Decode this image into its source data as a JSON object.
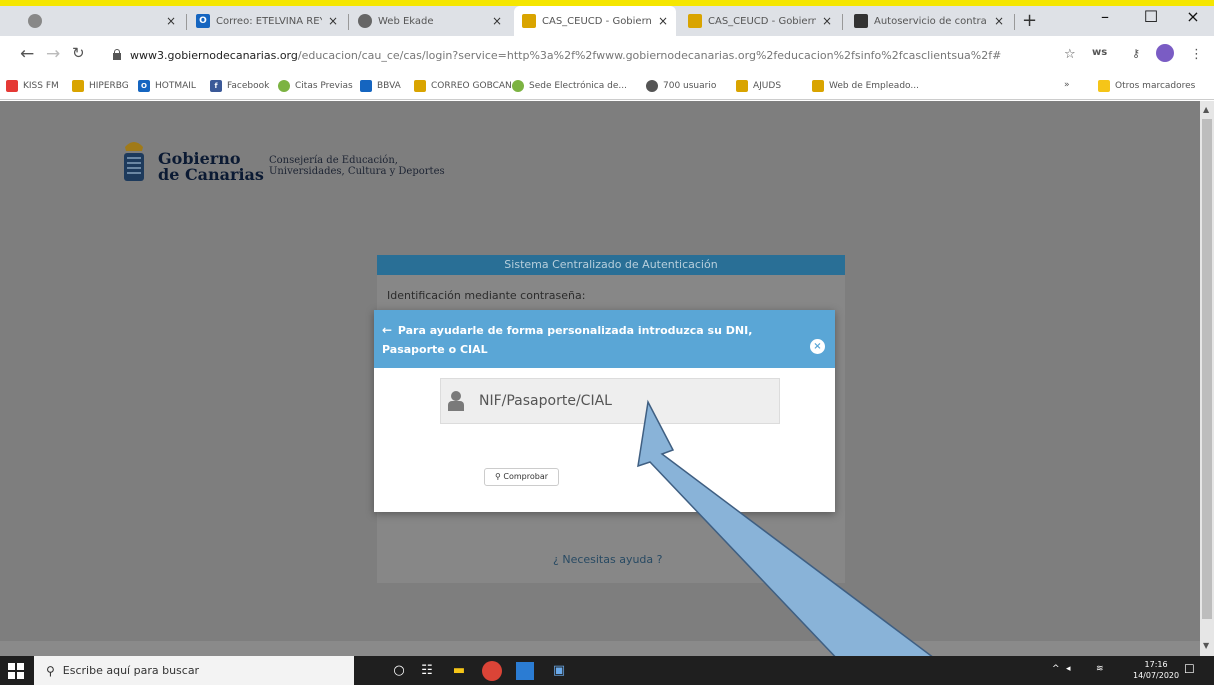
{
  "tabs": [
    {
      "label": "",
      "active": false
    },
    {
      "label": "Correo: ETELVINA REYE",
      "active": false
    },
    {
      "label": "Web Ekade",
      "active": false
    },
    {
      "label": "CAS_CEUCD - Gobierno",
      "active": true
    },
    {
      "label": "CAS_CEUCD - Gobierno",
      "active": false
    },
    {
      "label": "Autoservicio de contra",
      "active": false
    }
  ],
  "omnibox": {
    "host": "www3.gobiernodecanarias.org",
    "path": "/educacion/cau_ce/cas/login?service=http%3a%2f%2fwww.gobiernodecanarias.org%2feducacion%2fsinfo%2fcasclientsua%2f#"
  },
  "bookmarks": [
    "KISS FM",
    "HIPERBG",
    "HOTMAIL",
    "Facebook",
    "Citas Previas",
    "BBVA",
    "CORREO GOBCAN",
    "Sede Electrónica de...",
    "700 usuario",
    "AJUDS",
    "Web de Empleado...",
    "Otros marcadores"
  ],
  "header": {
    "logo_line1": "Gobierno",
    "logo_line2": "de Canarias",
    "dept_line1": "Consejería de Educación,",
    "dept_line2": "Universidades, Cultura y Deportes"
  },
  "login": {
    "title": "Sistema Centralizado de Autenticación",
    "subtitle": "Identificación mediante contraseña:",
    "help": "¿ Necesitas ayuda ?"
  },
  "modal": {
    "line1": "Para ayudarle de forma personalizada introduzca su DNI,",
    "line2": "Pasaporte o CIAL",
    "placeholder": "NIF/Pasaporte/CIAL",
    "button": "Comprobar"
  },
  "taskbar": {
    "search_placeholder": "Escribe aquí para buscar",
    "time": "17:16",
    "date": "14/07/2020"
  },
  "colors": {
    "accent": "#5aa6d6",
    "panel_header": "#296f96",
    "annotation_arrow": "#89b3d8"
  }
}
